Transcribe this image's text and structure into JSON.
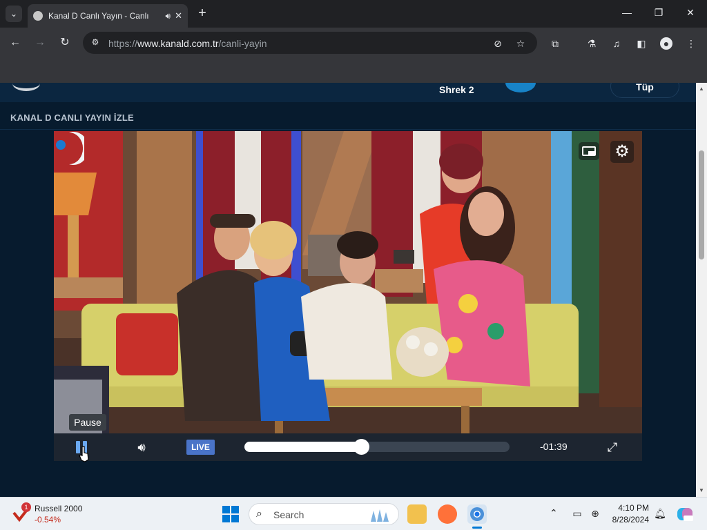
{
  "browser": {
    "tab_title": "Kanal D Canlı Yayın - Canlı",
    "url_prefix": "https://",
    "url_domain": "www.kanald.com.tr",
    "url_path": "/canli-yayin",
    "icons": [
      "tab-list-icon",
      "speaker-icon",
      "close-icon",
      "plus-icon",
      "minimize-icon",
      "restore-icon",
      "close-window-icon",
      "back-icon",
      "forward-icon",
      "reload-icon",
      "site-settings-icon",
      "eye-off-icon",
      "star-icon",
      "extensions-icon",
      "labs-icon",
      "media-control-icon",
      "side-panel-icon",
      "profile-icon",
      "menu-icon"
    ]
  },
  "header": {
    "show_title": "Shrek 2",
    "button_label": "Tüp"
  },
  "section": {
    "title": "KANAL D CANLI YAYIN İZLE"
  },
  "player": {
    "live_label": "LIVE",
    "time_remaining": "-01:39",
    "tooltip": "Pause",
    "progress_fraction": 0.44,
    "accent_color": "#4a74c8"
  },
  "taskbar": {
    "widget_name": "Russell 2000",
    "widget_value": "-0.54%",
    "widget_badge": "1",
    "search_placeholder": "Search",
    "time": "4:10 PM",
    "date": "8/28/2024"
  }
}
